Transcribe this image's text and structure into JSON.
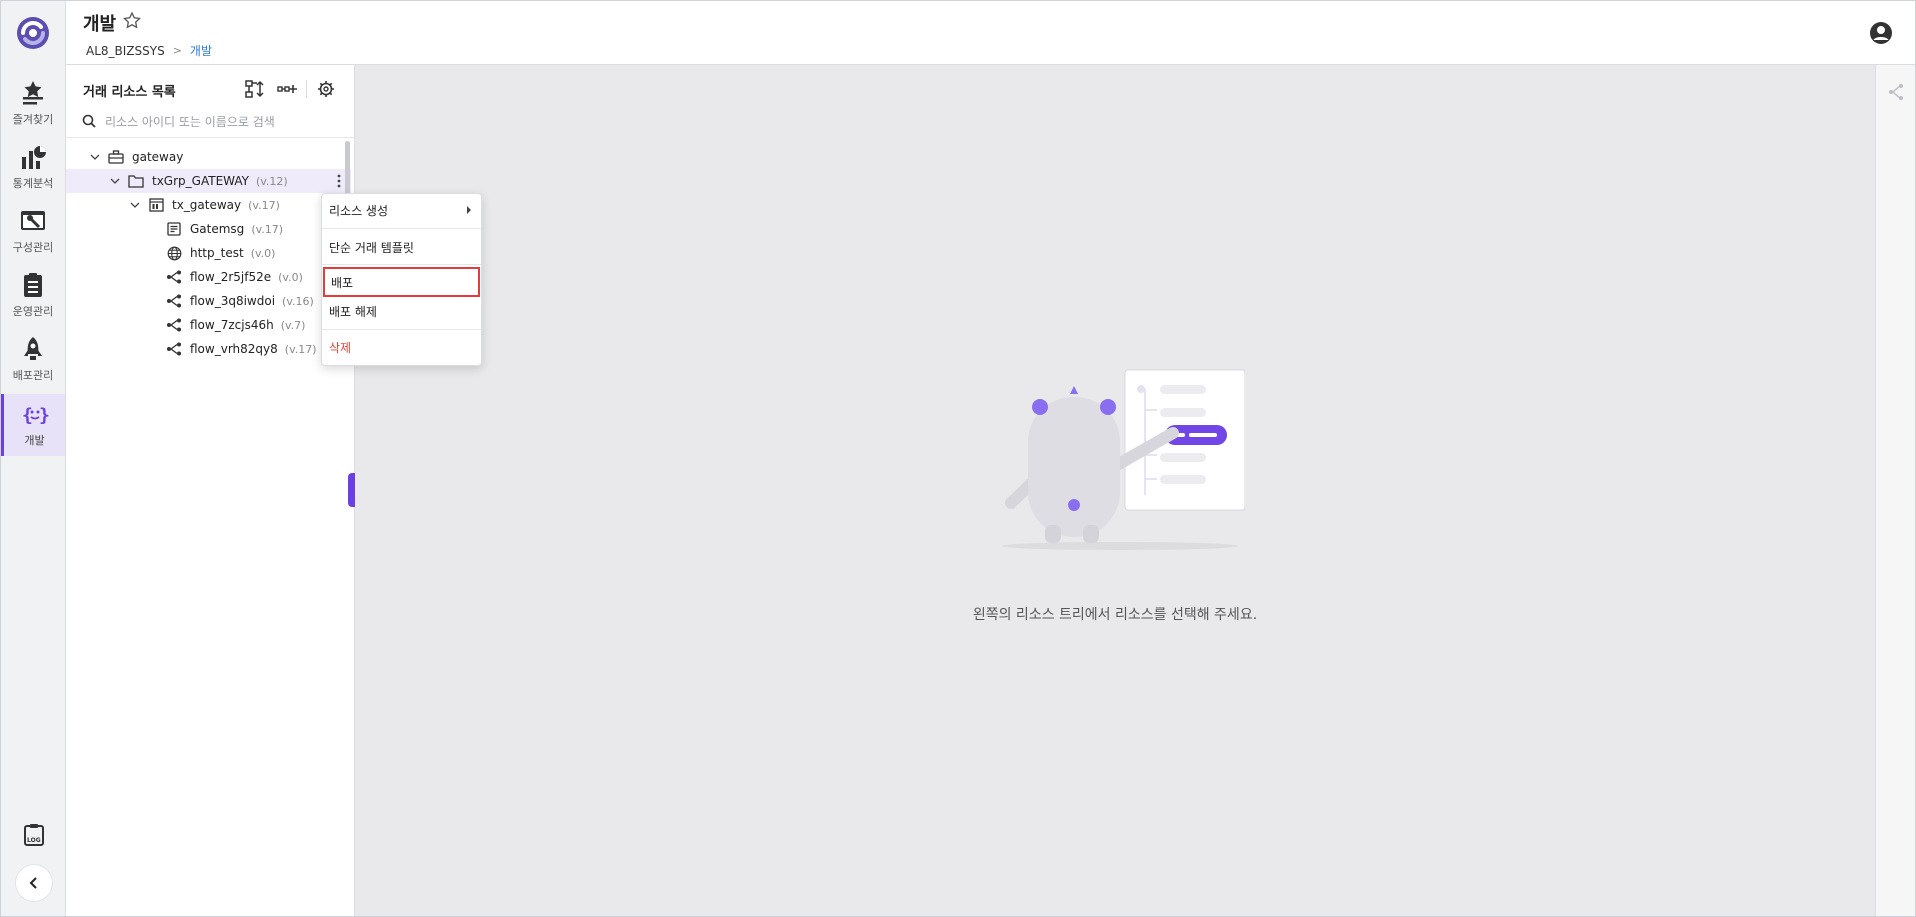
{
  "header": {
    "title": "개발",
    "breadcrumb": [
      "AL8_BIZSSYS",
      "개발"
    ]
  },
  "rail": {
    "items": [
      {
        "label": "즐겨찾기",
        "icon": "favorites-icon"
      },
      {
        "label": "통계분석",
        "icon": "statistics-icon"
      },
      {
        "label": "구성관리",
        "icon": "configuration-icon"
      },
      {
        "label": "운영관리",
        "icon": "operations-icon"
      },
      {
        "label": "배포관리",
        "icon": "deployment-icon"
      },
      {
        "label": "개발",
        "icon": "development-icon",
        "active": true
      }
    ]
  },
  "panel": {
    "title": "거래 리소스 목록",
    "search_placeholder": "리소스 아이디 또는 이름으로 검색"
  },
  "tree": [
    {
      "name": "gateway",
      "version": "",
      "type": "briefcase",
      "level": 0,
      "expanded": true
    },
    {
      "name": "txGrp_GATEWAY",
      "version": "(v.12)",
      "type": "folder",
      "level": 1,
      "expanded": true,
      "selected": true
    },
    {
      "name": "tx_gateway",
      "version": "(v.17)",
      "type": "transaction",
      "level": 2,
      "expanded": true
    },
    {
      "name": "Gatemsg",
      "version": "(v.17)",
      "type": "message",
      "level": 3
    },
    {
      "name": "http_test",
      "version": "(v.0)",
      "type": "globe",
      "level": 3
    },
    {
      "name": "flow_2r5jf52e",
      "version": "(v.0)",
      "type": "flow",
      "level": 3
    },
    {
      "name": "flow_3q8iwdoi",
      "version": "(v.16)",
      "type": "flow",
      "level": 3
    },
    {
      "name": "flow_7zcjs46h",
      "version": "(v.7)",
      "type": "flow",
      "level": 3
    },
    {
      "name": "flow_vrh82qy8",
      "version": "(v.17)",
      "type": "flow",
      "level": 3
    }
  ],
  "context_menu": {
    "create_resource": "리소스 생성",
    "simple_template": "단순 거래 템플릿",
    "deploy": "배포",
    "undeploy": "배포 해제",
    "delete": "삭제"
  },
  "main": {
    "empty_message": "왼쪽의 리소스 트리에서 리소스를 선택해 주세요."
  },
  "colors": {
    "accent": "#6b3fe0",
    "link": "#2f7de0",
    "danger": "#e0473b",
    "highlight_border": "#e53b3b"
  }
}
